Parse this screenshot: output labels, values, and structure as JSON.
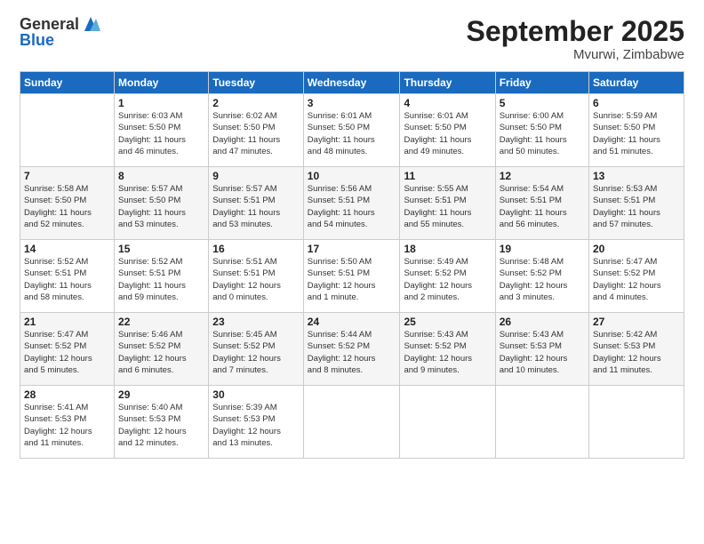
{
  "header": {
    "logo_general": "General",
    "logo_blue": "Blue",
    "month_title": "September 2025",
    "subtitle": "Mvurwi, Zimbabwe"
  },
  "weekdays": [
    "Sunday",
    "Monday",
    "Tuesday",
    "Wednesday",
    "Thursday",
    "Friday",
    "Saturday"
  ],
  "weeks": [
    [
      {
        "day": "",
        "info": ""
      },
      {
        "day": "1",
        "info": "Sunrise: 6:03 AM\nSunset: 5:50 PM\nDaylight: 11 hours\nand 46 minutes."
      },
      {
        "day": "2",
        "info": "Sunrise: 6:02 AM\nSunset: 5:50 PM\nDaylight: 11 hours\nand 47 minutes."
      },
      {
        "day": "3",
        "info": "Sunrise: 6:01 AM\nSunset: 5:50 PM\nDaylight: 11 hours\nand 48 minutes."
      },
      {
        "day": "4",
        "info": "Sunrise: 6:01 AM\nSunset: 5:50 PM\nDaylight: 11 hours\nand 49 minutes."
      },
      {
        "day": "5",
        "info": "Sunrise: 6:00 AM\nSunset: 5:50 PM\nDaylight: 11 hours\nand 50 minutes."
      },
      {
        "day": "6",
        "info": "Sunrise: 5:59 AM\nSunset: 5:50 PM\nDaylight: 11 hours\nand 51 minutes."
      }
    ],
    [
      {
        "day": "7",
        "info": "Sunrise: 5:58 AM\nSunset: 5:50 PM\nDaylight: 11 hours\nand 52 minutes."
      },
      {
        "day": "8",
        "info": "Sunrise: 5:57 AM\nSunset: 5:50 PM\nDaylight: 11 hours\nand 53 minutes."
      },
      {
        "day": "9",
        "info": "Sunrise: 5:57 AM\nSunset: 5:51 PM\nDaylight: 11 hours\nand 53 minutes."
      },
      {
        "day": "10",
        "info": "Sunrise: 5:56 AM\nSunset: 5:51 PM\nDaylight: 11 hours\nand 54 minutes."
      },
      {
        "day": "11",
        "info": "Sunrise: 5:55 AM\nSunset: 5:51 PM\nDaylight: 11 hours\nand 55 minutes."
      },
      {
        "day": "12",
        "info": "Sunrise: 5:54 AM\nSunset: 5:51 PM\nDaylight: 11 hours\nand 56 minutes."
      },
      {
        "day": "13",
        "info": "Sunrise: 5:53 AM\nSunset: 5:51 PM\nDaylight: 11 hours\nand 57 minutes."
      }
    ],
    [
      {
        "day": "14",
        "info": "Sunrise: 5:52 AM\nSunset: 5:51 PM\nDaylight: 11 hours\nand 58 minutes."
      },
      {
        "day": "15",
        "info": "Sunrise: 5:52 AM\nSunset: 5:51 PM\nDaylight: 11 hours\nand 59 minutes."
      },
      {
        "day": "16",
        "info": "Sunrise: 5:51 AM\nSunset: 5:51 PM\nDaylight: 12 hours\nand 0 minutes."
      },
      {
        "day": "17",
        "info": "Sunrise: 5:50 AM\nSunset: 5:51 PM\nDaylight: 12 hours\nand 1 minute."
      },
      {
        "day": "18",
        "info": "Sunrise: 5:49 AM\nSunset: 5:52 PM\nDaylight: 12 hours\nand 2 minutes."
      },
      {
        "day": "19",
        "info": "Sunrise: 5:48 AM\nSunset: 5:52 PM\nDaylight: 12 hours\nand 3 minutes."
      },
      {
        "day": "20",
        "info": "Sunrise: 5:47 AM\nSunset: 5:52 PM\nDaylight: 12 hours\nand 4 minutes."
      }
    ],
    [
      {
        "day": "21",
        "info": "Sunrise: 5:47 AM\nSunset: 5:52 PM\nDaylight: 12 hours\nand 5 minutes."
      },
      {
        "day": "22",
        "info": "Sunrise: 5:46 AM\nSunset: 5:52 PM\nDaylight: 12 hours\nand 6 minutes."
      },
      {
        "day": "23",
        "info": "Sunrise: 5:45 AM\nSunset: 5:52 PM\nDaylight: 12 hours\nand 7 minutes."
      },
      {
        "day": "24",
        "info": "Sunrise: 5:44 AM\nSunset: 5:52 PM\nDaylight: 12 hours\nand 8 minutes."
      },
      {
        "day": "25",
        "info": "Sunrise: 5:43 AM\nSunset: 5:52 PM\nDaylight: 12 hours\nand 9 minutes."
      },
      {
        "day": "26",
        "info": "Sunrise: 5:43 AM\nSunset: 5:53 PM\nDaylight: 12 hours\nand 10 minutes."
      },
      {
        "day": "27",
        "info": "Sunrise: 5:42 AM\nSunset: 5:53 PM\nDaylight: 12 hours\nand 11 minutes."
      }
    ],
    [
      {
        "day": "28",
        "info": "Sunrise: 5:41 AM\nSunset: 5:53 PM\nDaylight: 12 hours\nand 11 minutes."
      },
      {
        "day": "29",
        "info": "Sunrise: 5:40 AM\nSunset: 5:53 PM\nDaylight: 12 hours\nand 12 minutes."
      },
      {
        "day": "30",
        "info": "Sunrise: 5:39 AM\nSunset: 5:53 PM\nDaylight: 12 hours\nand 13 minutes."
      },
      {
        "day": "",
        "info": ""
      },
      {
        "day": "",
        "info": ""
      },
      {
        "day": "",
        "info": ""
      },
      {
        "day": "",
        "info": ""
      }
    ]
  ]
}
